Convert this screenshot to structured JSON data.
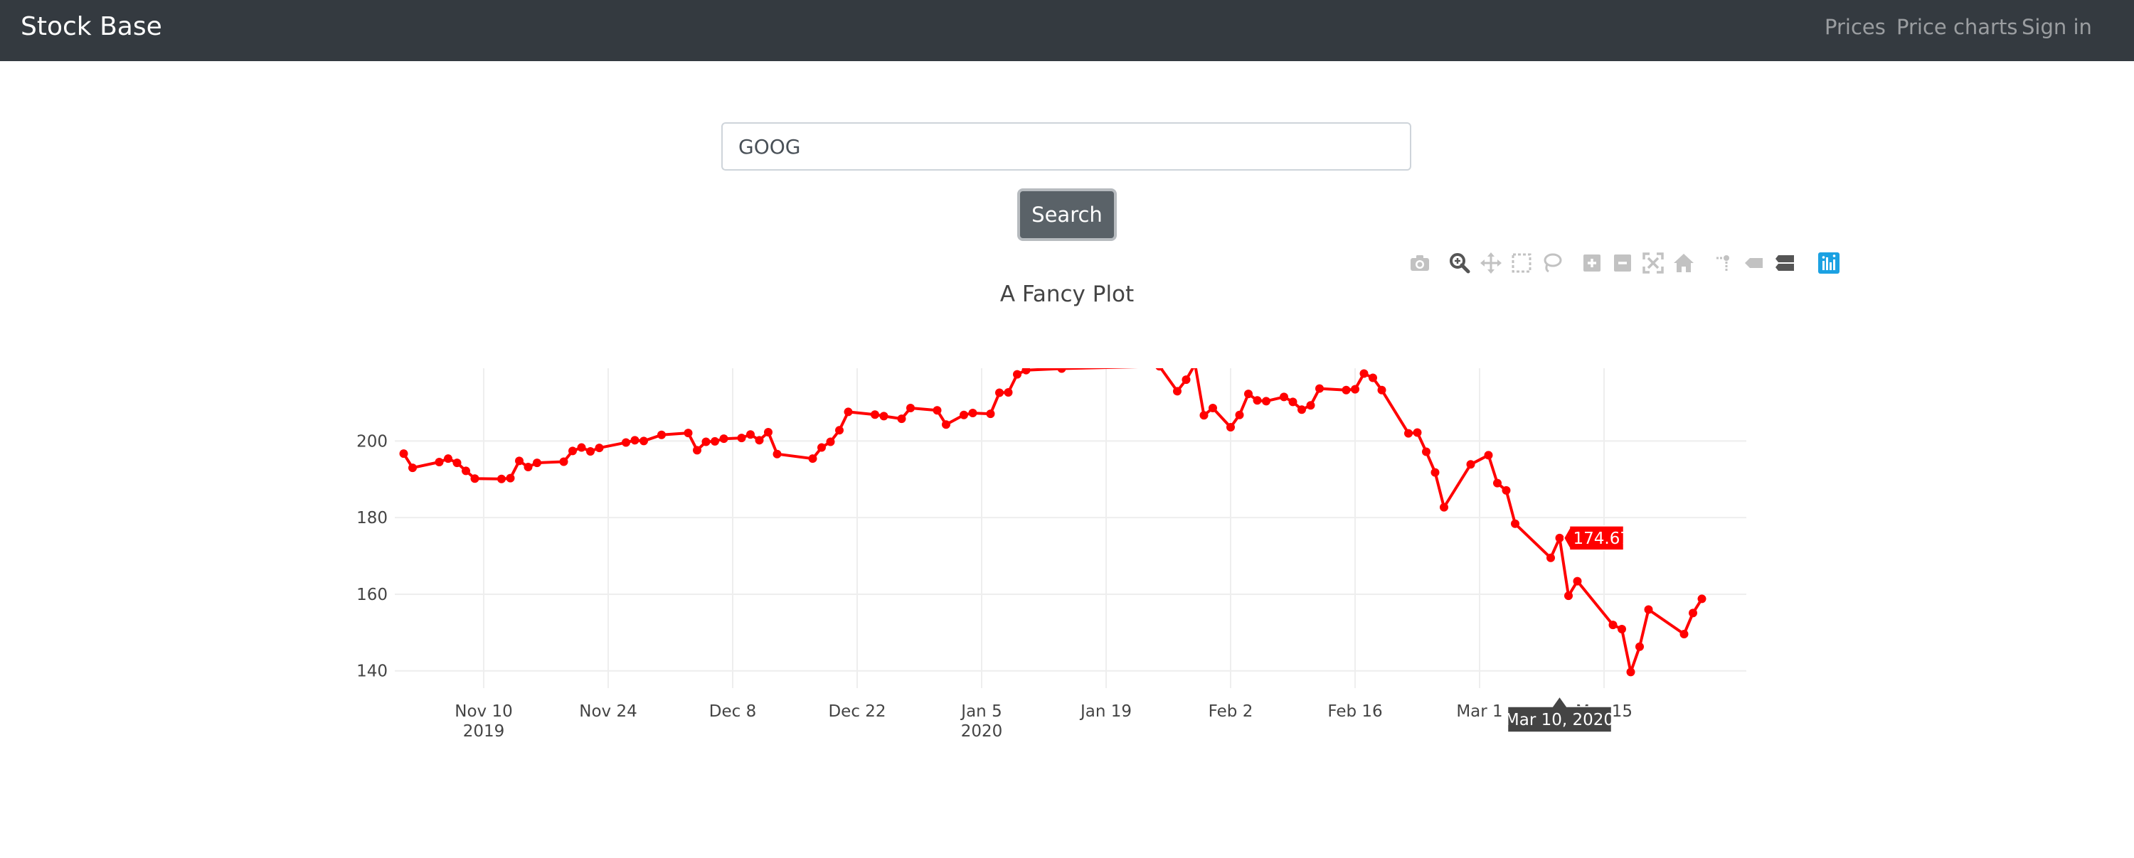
{
  "navbar": {
    "brand": "Stock Base",
    "links": [
      "Prices",
      "Price charts",
      "Sign in"
    ]
  },
  "search": {
    "value": "GOOG",
    "button_label": "Search"
  },
  "modebar": {
    "buttons": [
      "camera-icon",
      "zoom-icon",
      "pan-icon",
      "box-select-icon",
      "lasso-select-icon",
      "zoom-in-icon",
      "zoom-out-icon",
      "autoscale-icon",
      "reset-axes-icon",
      "spike-lines-icon",
      "hover-closest-icon",
      "hover-compare-icon",
      "plotly-logo-icon"
    ]
  },
  "colors": {
    "navbar": "#343a40",
    "line": "#ff0000",
    "button": "#5a6268",
    "modebar_active": "#1ba1e2"
  },
  "chart_data": {
    "type": "line",
    "title": "A Fancy Plot",
    "xlabel": "",
    "ylabel": "",
    "x_ticks": [
      {
        "date": "2019-11-10",
        "label": "Nov 10",
        "sub": "2019"
      },
      {
        "date": "2019-11-24",
        "label": "Nov 24",
        "sub": ""
      },
      {
        "date": "2019-12-08",
        "label": "Dec 8",
        "sub": ""
      },
      {
        "date": "2019-12-22",
        "label": "Dec 22",
        "sub": ""
      },
      {
        "date": "2020-01-05",
        "label": "Jan 5",
        "sub": "2020"
      },
      {
        "date": "2020-01-19",
        "label": "Jan 19",
        "sub": ""
      },
      {
        "date": "2020-02-02",
        "label": "Feb 2",
        "sub": ""
      },
      {
        "date": "2020-02-16",
        "label": "Feb 16",
        "sub": ""
      },
      {
        "date": "2020-03-01",
        "label": "Mar 1",
        "sub": ""
      },
      {
        "date": "2020-03-15",
        "label": "Mar 15",
        "sub": ""
      }
    ],
    "y_ticks": [
      140,
      160,
      180,
      200
    ],
    "xlim": [
      "2019-10-31",
      "2020-03-31"
    ],
    "ylim": [
      135.5,
      219
    ],
    "grid": true,
    "hover": {
      "x": "Mar 10, 2020",
      "y": "174.67"
    },
    "series": [
      {
        "points": [
          [
            "2019-11-01",
            196.7
          ],
          [
            "2019-11-02",
            193.0
          ],
          [
            "2019-11-05",
            194.5
          ],
          [
            "2019-11-06",
            195.4
          ],
          [
            "2019-11-07",
            194.3
          ],
          [
            "2019-11-08",
            192.2
          ],
          [
            "2019-11-09",
            190.2
          ],
          [
            "2019-11-12",
            190.1
          ],
          [
            "2019-11-13",
            190.3
          ],
          [
            "2019-11-14",
            194.8
          ],
          [
            "2019-11-15",
            193.2
          ],
          [
            "2019-11-16",
            194.3
          ],
          [
            "2019-11-19",
            194.6
          ],
          [
            "2019-11-20",
            197.4
          ],
          [
            "2019-11-21",
            198.3
          ],
          [
            "2019-11-22",
            197.3
          ],
          [
            "2019-11-23",
            198.2
          ],
          [
            "2019-11-26",
            199.6
          ],
          [
            "2019-11-27",
            200.2
          ],
          [
            "2019-11-28",
            200.0
          ],
          [
            "2019-11-30",
            201.6
          ],
          [
            "2019-12-03",
            202.1
          ],
          [
            "2019-12-04",
            197.6
          ],
          [
            "2019-12-05",
            199.8
          ],
          [
            "2019-12-06",
            199.9
          ],
          [
            "2019-12-07",
            200.6
          ],
          [
            "2019-12-09",
            200.8
          ],
          [
            "2019-12-10",
            201.7
          ],
          [
            "2019-12-11",
            200.2
          ],
          [
            "2019-12-12",
            202.3
          ],
          [
            "2019-12-13",
            196.6
          ],
          [
            "2019-12-17",
            195.4
          ],
          [
            "2019-12-18",
            198.3
          ],
          [
            "2019-12-19",
            199.8
          ],
          [
            "2019-12-20",
            202.8
          ],
          [
            "2019-12-21",
            207.6
          ],
          [
            "2019-12-24",
            206.9
          ],
          [
            "2019-12-25",
            206.5
          ],
          [
            "2019-12-27",
            205.8
          ],
          [
            "2019-12-28",
            208.6
          ],
          [
            "2019-12-31",
            208.0
          ],
          [
            "2020-01-01",
            204.3
          ],
          [
            "2020-01-03",
            206.8
          ],
          [
            "2020-01-04",
            207.3
          ],
          [
            "2020-01-06",
            207.1
          ],
          [
            "2020-01-07",
            212.6
          ],
          [
            "2020-01-08",
            212.7
          ],
          [
            "2020-01-09",
            217.4
          ],
          [
            "2020-01-10",
            218.5
          ],
          [
            "2020-01-14",
            218.9
          ],
          [
            "2020-01-25",
            219.5
          ],
          [
            "2020-01-27",
            213.0
          ],
          [
            "2020-01-28",
            216.0
          ],
          [
            "2020-01-29",
            220.0
          ],
          [
            "2020-01-30",
            206.7
          ],
          [
            "2020-01-31",
            208.6
          ],
          [
            "2020-02-02",
            203.6
          ],
          [
            "2020-02-03",
            206.8
          ],
          [
            "2020-02-04",
            212.3
          ],
          [
            "2020-02-05",
            210.6
          ],
          [
            "2020-02-06",
            210.4
          ],
          [
            "2020-02-08",
            211.5
          ],
          [
            "2020-02-09",
            210.2
          ],
          [
            "2020-02-10",
            208.2
          ],
          [
            "2020-02-11",
            209.3
          ],
          [
            "2020-02-12",
            213.7
          ],
          [
            "2020-02-15",
            213.3
          ],
          [
            "2020-02-16",
            213.5
          ],
          [
            "2020-02-17",
            217.6
          ],
          [
            "2020-02-18",
            216.5
          ],
          [
            "2020-02-19",
            213.3
          ],
          [
            "2020-02-22",
            202.0
          ],
          [
            "2020-02-23",
            202.2
          ],
          [
            "2020-02-24",
            197.2
          ],
          [
            "2020-02-25",
            191.8
          ],
          [
            "2020-02-26",
            182.7
          ],
          [
            "2020-02-29",
            193.9
          ],
          [
            "2020-03-02",
            196.3
          ],
          [
            "2020-03-03",
            189.0
          ],
          [
            "2020-03-04",
            187.1
          ],
          [
            "2020-03-05",
            178.4
          ],
          [
            "2020-03-09",
            169.5
          ],
          [
            "2020-03-10",
            174.67
          ],
          [
            "2020-03-11",
            159.6
          ],
          [
            "2020-03-12",
            163.4
          ],
          [
            "2020-03-16",
            152.0
          ],
          [
            "2020-03-17",
            150.9
          ],
          [
            "2020-03-18",
            139.7
          ],
          [
            "2020-03-19",
            146.3
          ],
          [
            "2020-03-20",
            156.0
          ],
          [
            "2020-03-24",
            149.6
          ],
          [
            "2020-03-25",
            155.1
          ],
          [
            "2020-03-26",
            158.8
          ]
        ]
      }
    ]
  }
}
